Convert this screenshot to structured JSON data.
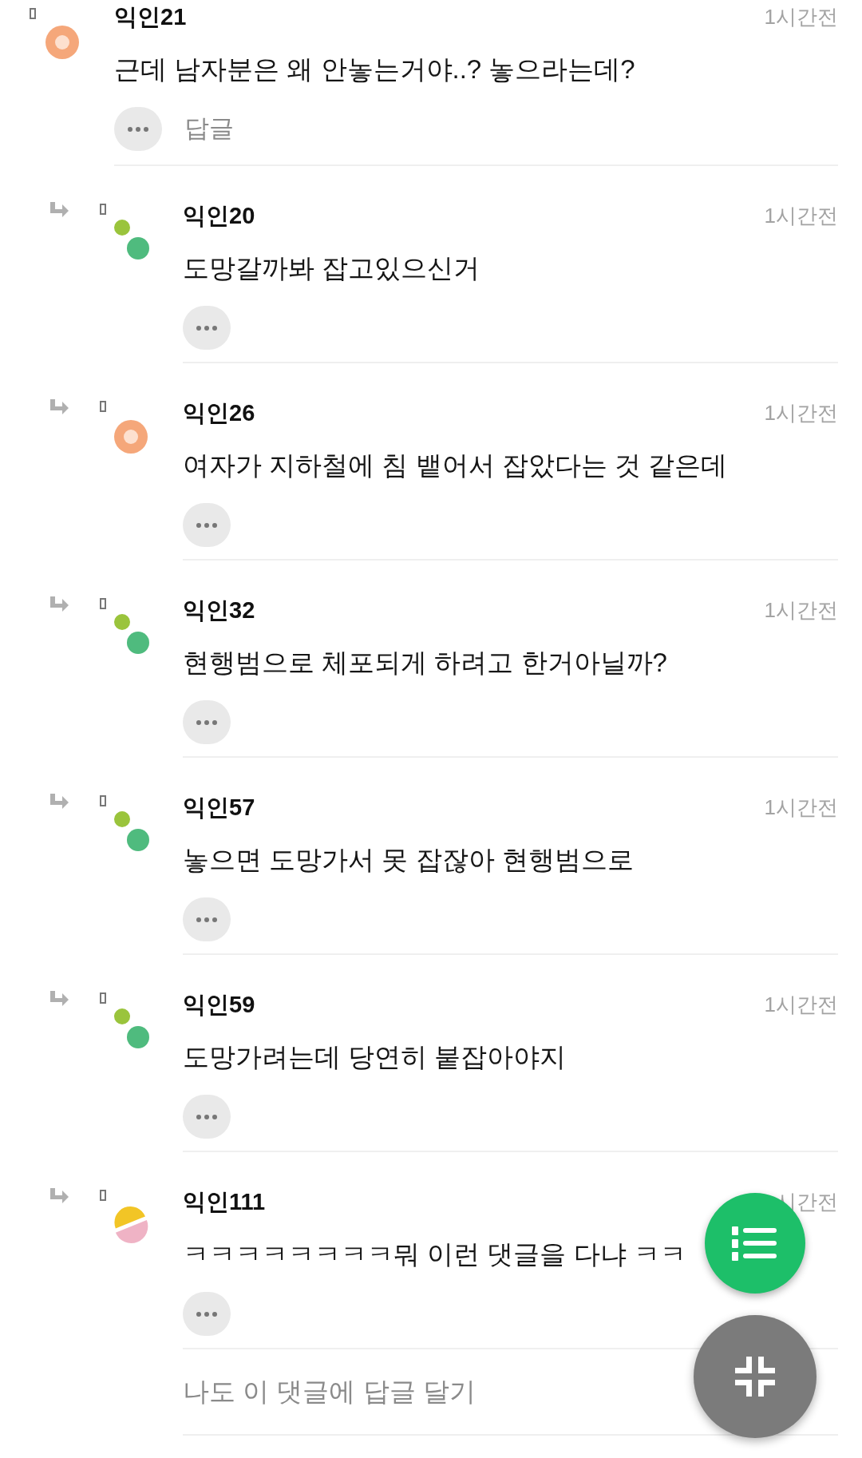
{
  "comment": {
    "author": "익인21",
    "time": "1시간전",
    "text": "근데 남자분은 왜 안놓는거야..? 놓으라는데?",
    "avatar": {
      "kind": "ring"
    },
    "reply_label": "답글"
  },
  "replies": [
    {
      "author": "익인20",
      "time": "1시간전",
      "text": "도망갈까봐 잡고있으신거",
      "avatar": {
        "kind": "dots"
      }
    },
    {
      "author": "익인26",
      "time": "1시간전",
      "text": "여자가 지하철에 침 뱉어서 잡았다는 것 같은데",
      "avatar": {
        "kind": "ring"
      }
    },
    {
      "author": "익인32",
      "time": "1시간전",
      "text": "현행범으로 체포되게 하려고 한거아닐까?",
      "avatar": {
        "kind": "dots"
      }
    },
    {
      "author": "익인57",
      "time": "1시간전",
      "text": "놓으면 도망가서 못 잡잖아 현행범으로",
      "avatar": {
        "kind": "dots"
      }
    },
    {
      "author": "익인59",
      "time": "1시간전",
      "text": "도망가려는데 당연히 붙잡아야지",
      "avatar": {
        "kind": "dots"
      }
    },
    {
      "author": "익인111",
      "time": "시간전",
      "text": "ㅋㅋㅋㅋㅋㅋㅋㅋ뭐 이런 댓글을 다냐 ㅋㅋ",
      "avatar": {
        "kind": "halves"
      }
    }
  ],
  "reply_prompt": "나도 이 댓글에 답글 달기"
}
